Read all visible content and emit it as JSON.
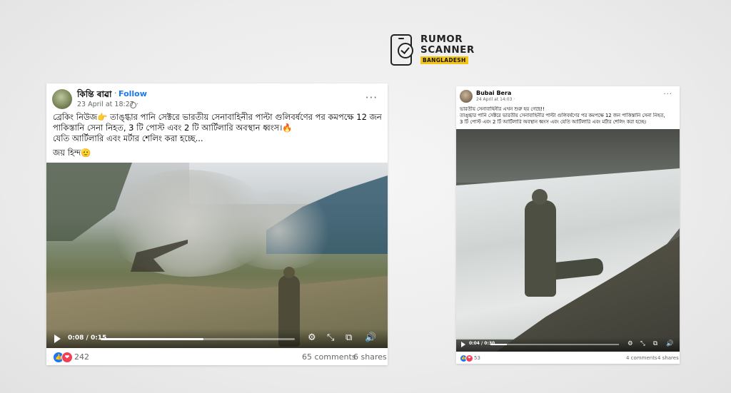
{
  "logo": {
    "line1": "RUMOR",
    "line2": "SCANNER",
    "line3": "BANGLADESH"
  },
  "post1": {
    "author": "কিন্তি ৰাৱা",
    "separator": "·",
    "follow": "Follow",
    "date": "23 April at 18:27 ·",
    "more": "···",
    "lines": [
      "ব্রেকিং নিউজ👉 তাঙ্গ্ধার পানি সেক্টরে ভারতীয় সেনাবাহিনীর পাল্টা গুলিবর্ষণের পর কমপক্ষে 12 জন",
      "পাকিস্তানি সেনা নিহত, 3 টি পোস্ট এবং 2 টি আর্টিলারি অবস্থান ধ্বংস।🔥",
      "যেতি আর্টিলারি এবং মর্টার শেলিং করা হচ্ছে..."
    ],
    "closing": "জয় হিন্দ🫡",
    "video": {
      "time": "0:08 / 0:15",
      "progress": 0.53
    },
    "controls": {
      "settings": "⚙",
      "fullscreen_exit": "⤡",
      "pip": "⧉",
      "volume": "🔊"
    },
    "reactions": {
      "like": "👍",
      "love": "❤",
      "count": "242"
    },
    "comments": "65 comments",
    "shares": "6 shares"
  },
  "post2": {
    "author": "Bubai Bera",
    "date": "24 April at 14:03 · ",
    "more": "···",
    "lines": [
      "ভারতীয় সেনাবাহিনীর এখন শুরু হয় গেছে!!",
      "তাঙ্গ্ধার পানি সেক্টরে ভারতীয় সেনাবাহিনীর পাল্টা গুলিবর্ষণের পর কমপক্ষে 12 জন পাকিস্তানি সেনা নিহত,",
      "3 টি পোস্ট এবং 2 টি আর্টিলারি অবস্থান ধ্বংস এবং যেতি আর্টিলারি এবং মর্টার শেলিং করা হচ্ছে।"
    ],
    "video": {
      "time": "0:04 / 0:30",
      "progress": 0.13
    },
    "controls": {
      "settings": "⚙",
      "fullscreen_exit": "⤡",
      "pip": "⧉",
      "volume": "🔊"
    },
    "reactions": {
      "like": "👍",
      "love": "❤",
      "count": "53"
    },
    "comments": "4 comments",
    "shares": "4 shares"
  }
}
